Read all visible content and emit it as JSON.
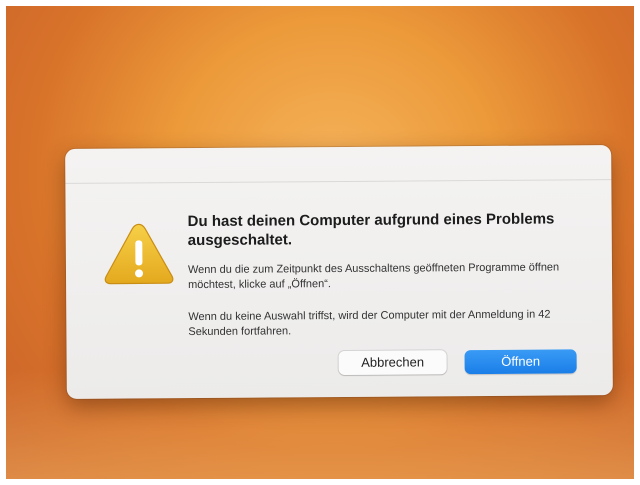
{
  "dialog": {
    "title": "Du hast deinen Computer aufgrund eines Problems ausgeschaltet.",
    "message": "Wenn du die zum Zeitpunkt des Ausschaltens geöffneten Programme öffnen möchtest, klicke auf „Öffnen“.",
    "info": "Wenn du keine Auswahl triffst, wird der Computer mit der Anmeldung in 42 Sekunden fortfahren.",
    "icon": "warning-icon",
    "buttons": {
      "cancel_label": "Abbrechen",
      "open_label": "Öffnen"
    }
  },
  "colors": {
    "accent": "#1a7ee8",
    "warning": "#f0c02a",
    "desktop": "#ec9a3a"
  }
}
